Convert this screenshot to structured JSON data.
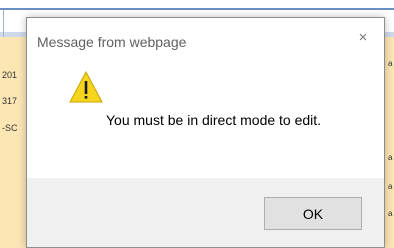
{
  "background": {
    "fragments_left": [
      "201",
      "317",
      "-SC"
    ],
    "fragments_right": [
      "a",
      "a",
      "a",
      "a"
    ]
  },
  "dialog": {
    "title": "Message from webpage",
    "close_glyph": "×",
    "message": "You must be in direct mode to edit.",
    "icon": "warning-icon",
    "ok_label": "OK"
  },
  "colors": {
    "warning_fill": "#f7d51d",
    "warning_stroke": "#c9a400",
    "footer_bg": "#f0f0f0",
    "button_bg": "#e1e1e1"
  }
}
